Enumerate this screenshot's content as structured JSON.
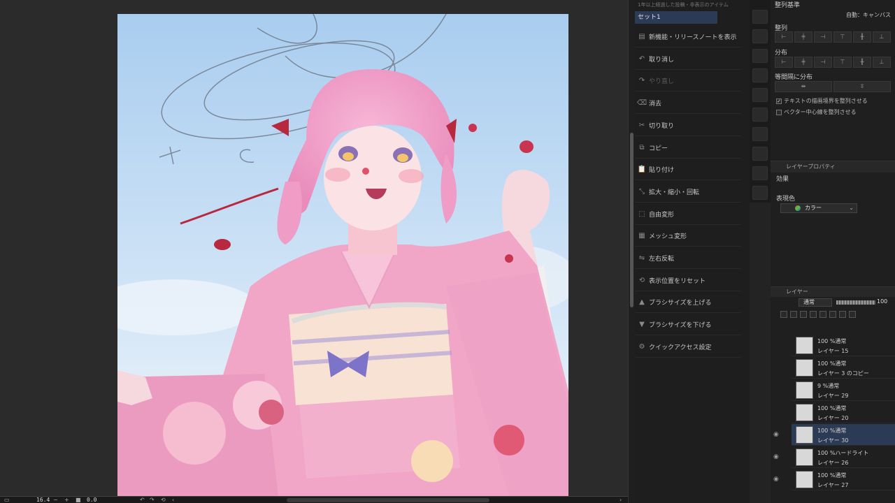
{
  "status_bar": {
    "zoom": "16.4",
    "rotation": "0.0"
  },
  "quick_access": {
    "title": "1年以上経過した投稿・非表示のアイテム",
    "selected_set": "セット1",
    "items": [
      {
        "icon": "info-icon",
        "label": "新機能・リリースノートを表示",
        "enabled": true
      },
      {
        "icon": "undo-icon",
        "label": "取り消し",
        "enabled": true
      },
      {
        "icon": "redo-icon",
        "label": "やり直し",
        "enabled": false
      },
      {
        "icon": "erase-icon",
        "label": "消去",
        "enabled": true
      },
      {
        "icon": "cut-icon",
        "label": "切り取り",
        "enabled": true
      },
      {
        "icon": "copy-icon",
        "label": "コピー",
        "enabled": true
      },
      {
        "icon": "paste-icon",
        "label": "貼り付け",
        "enabled": true
      },
      {
        "icon": "transform-icon",
        "label": "拡大・縮小・回転",
        "enabled": true
      },
      {
        "icon": "free-transform-icon",
        "label": "自由変形",
        "enabled": true
      },
      {
        "icon": "mesh-icon",
        "label": "メッシュ変形",
        "enabled": true
      },
      {
        "icon": "flip-icon",
        "label": "左右反転",
        "enabled": true
      },
      {
        "icon": "reset-view-icon",
        "label": "表示位置をリセット",
        "enabled": true
      },
      {
        "icon": "brush-up-icon",
        "label": "ブラシサイズを上げる",
        "enabled": true
      },
      {
        "icon": "brush-down-icon",
        "label": "ブラシサイズを下げる",
        "enabled": true
      },
      {
        "icon": "settings-icon",
        "label": "クイックアクセス設定",
        "enabled": true
      }
    ]
  },
  "align_panel": {
    "title": "整列基準",
    "target": "自動：キャンバス",
    "align_label": "整列",
    "distribute_label": "分布",
    "equal_spacing_label": "等間隔に分布",
    "checkbox_text": {
      "label": "テキストの描画境界を整列させる",
      "checked": true
    },
    "checkbox_vector": {
      "label": "ベクター中心線を整列させる",
      "checked": false
    }
  },
  "layer_property": {
    "tab": "レイヤープロパティ",
    "effect_label": "効果",
    "expression_label": "表現色",
    "expression_value": "カラー"
  },
  "layer_panel": {
    "tab": "レイヤー",
    "blend_mode": "通常",
    "opacity": "100",
    "layers": [
      {
        "mode": "100 %通常",
        "name": "レイヤー 15",
        "selected": false,
        "visible": false
      },
      {
        "mode": "100 %通常",
        "name": "レイヤー 3 のコピー",
        "selected": false,
        "visible": false
      },
      {
        "mode": "9 %通常",
        "name": "レイヤー 29",
        "selected": false,
        "visible": false
      },
      {
        "mode": "100 %通常",
        "name": "レイヤー 20",
        "selected": false,
        "visible": false
      },
      {
        "mode": "100 %通常",
        "name": "レイヤー 30",
        "selected": true,
        "visible": true
      },
      {
        "mode": "100 %ハードライト",
        "name": "レイヤー 26",
        "selected": false,
        "visible": true
      },
      {
        "mode": "100 %通常",
        "name": "レイヤー 27",
        "selected": false,
        "visible": true
      }
    ]
  }
}
